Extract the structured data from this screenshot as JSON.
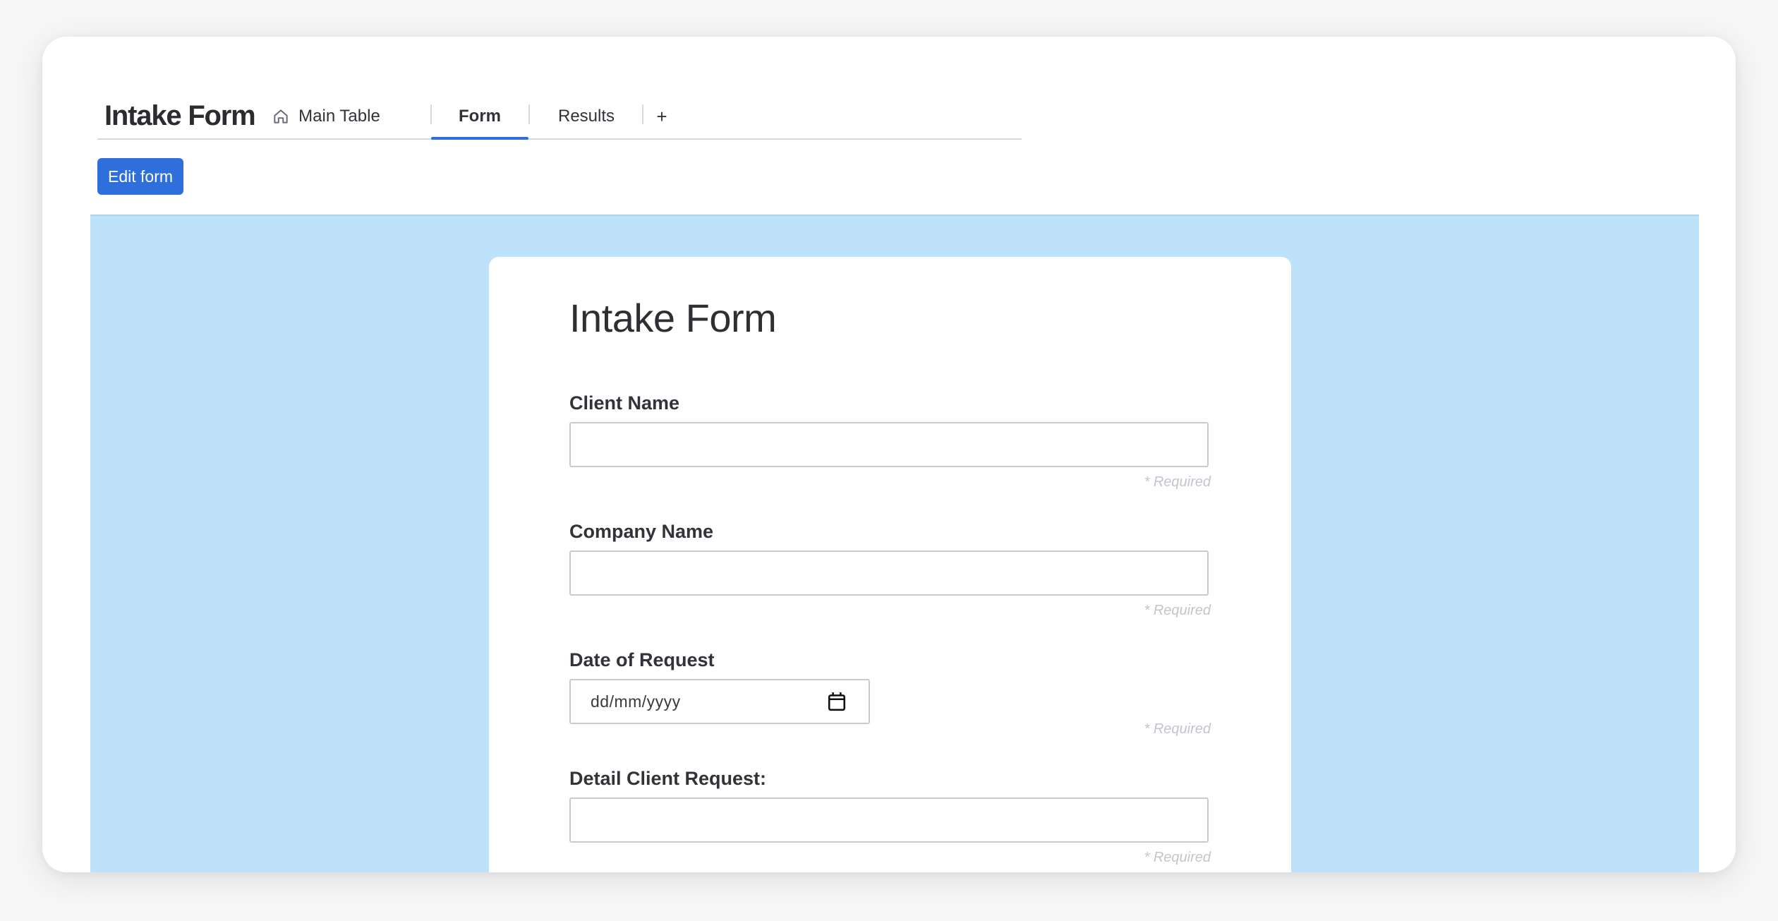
{
  "board": {
    "title": "Intake Form",
    "tabs": [
      {
        "label": "Main Table",
        "icon": "home-icon",
        "active": false
      },
      {
        "label": "Form",
        "active": true
      },
      {
        "label": "Results",
        "active": false
      }
    ],
    "add_tab_label": "+"
  },
  "toolbar": {
    "edit_form_label": "Edit form"
  },
  "colors": {
    "accent": "#2f6fdb",
    "canvas_bg": "#bde2fa"
  },
  "form": {
    "title": "Intake Form",
    "fields": [
      {
        "label": "Client Name",
        "type": "text",
        "value": "",
        "required_note": "* Required"
      },
      {
        "label": "Company Name",
        "type": "text",
        "value": "",
        "required_note": "* Required"
      },
      {
        "label": "Date of Request",
        "type": "date",
        "placeholder": "dd/mm/yyyy",
        "required_note": "* Required"
      },
      {
        "label": "Detail Client Request:",
        "type": "text",
        "value": "",
        "required_note": "* Required"
      }
    ]
  }
}
